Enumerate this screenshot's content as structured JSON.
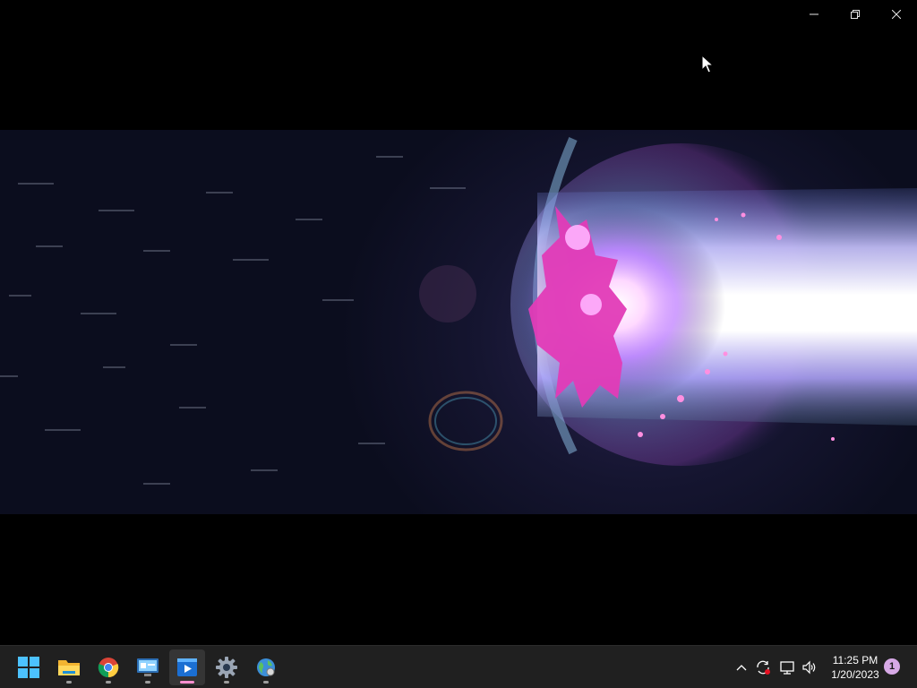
{
  "window": {
    "controls": {
      "minimize": "minimize-icon",
      "restore": "restore-icon",
      "close": "close-icon"
    }
  },
  "video": {
    "content": "anime energy-beam frame"
  },
  "taskbar": {
    "apps": [
      {
        "name": "start-button",
        "icon": "windows-start-icon"
      },
      {
        "name": "file-explorer",
        "icon": "folder-icon"
      },
      {
        "name": "chrome",
        "icon": "chrome-icon"
      },
      {
        "name": "control-panel",
        "icon": "control-panel-icon"
      },
      {
        "name": "media-player",
        "icon": "media-player-icon"
      },
      {
        "name": "settings",
        "icon": "gear-icon"
      },
      {
        "name": "network-app",
        "icon": "globe-icon"
      }
    ],
    "tray": {
      "icons": [
        "chevron-up-icon",
        "sync-icon",
        "network-icon",
        "volume-icon"
      ],
      "time": "11:25 PM",
      "date": "1/20/2023",
      "notification_count": "1"
    }
  },
  "colors": {
    "taskbar_bg": "#202020",
    "accent": "#ff8fd0",
    "beam": "#ffffff",
    "glow": "#b03cff"
  }
}
